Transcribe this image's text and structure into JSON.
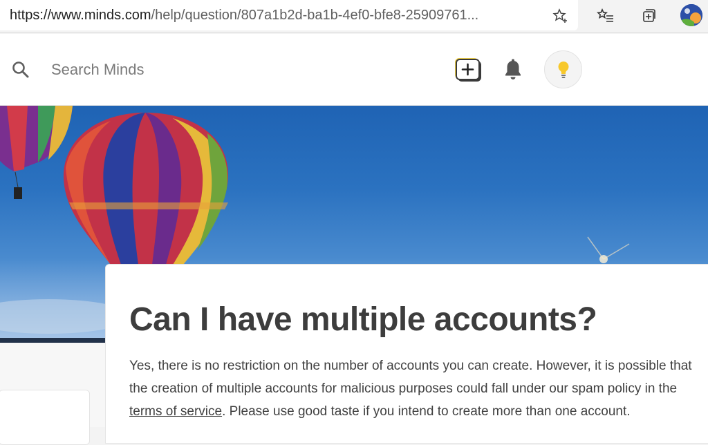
{
  "browser": {
    "url_prefix": "https://www.",
    "url_host": "minds.com",
    "url_path": "/help/question/807a1b2d-ba1b-4ef0-bfe8-25909761...",
    "icons": [
      "star-add-icon",
      "favorites-icon",
      "collections-icon",
      "profile-avatar"
    ]
  },
  "header": {
    "search_placeholder": "Search Minds",
    "icons": [
      "search-icon",
      "compose-icon",
      "bell-icon",
      "bulb-icon"
    ]
  },
  "article": {
    "title": "Can I have multiple accounts?",
    "body_part1": "Yes, there is no restriction on the number of accounts you can create. However, it is possible that the creation of multiple accounts for malicious purposes could fall under our spam policy in the ",
    "link_text": "terms of service",
    "body_part2": ". Please use good taste if you intend to create more than one account."
  },
  "colors": {
    "accent_yellow": "#f5d547",
    "sky": "#2b72c0",
    "text": "#3d3d3d"
  }
}
